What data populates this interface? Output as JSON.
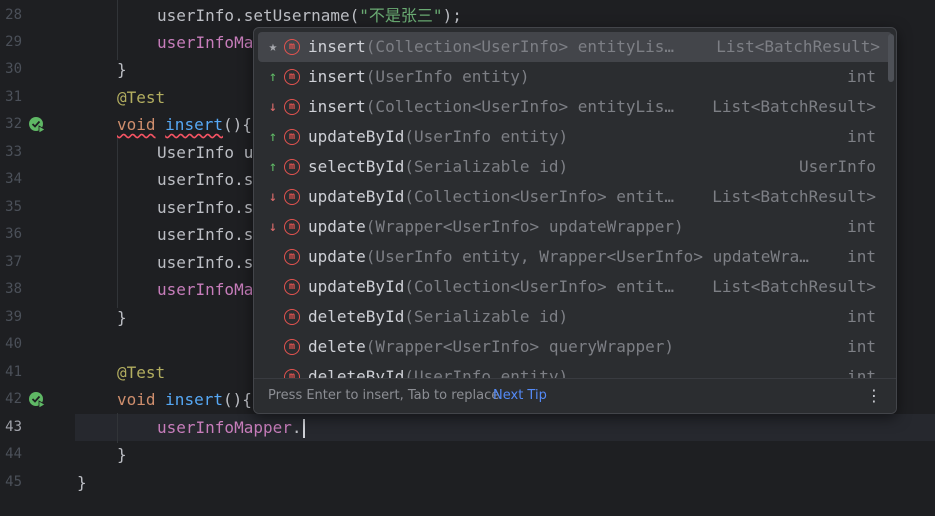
{
  "gutter": {
    "line_numbers": [
      "28",
      "29",
      "30",
      "31",
      "32",
      "33",
      "34",
      "35",
      "36",
      "37",
      "38",
      "39",
      "40",
      "41",
      "42",
      "43",
      "44",
      "45"
    ],
    "current_line": "43"
  },
  "code": {
    "l28": {
      "a": "userInfo.setUsername(",
      "b": "\"不是张三\"",
      "c": ");"
    },
    "l29": {
      "a": "userInfoMa"
    },
    "l30": {
      "a": "}"
    },
    "l31": {
      "a": "@Test"
    },
    "l32": {
      "kw": "void",
      "fn": "insert",
      "rest": "(){"
    },
    "l33": {
      "a": "UserInfo u"
    },
    "l34": {
      "a": "userInfo.s"
    },
    "l35": {
      "a": "userInfo.s"
    },
    "l36": {
      "a": "userInfo.s"
    },
    "l37": {
      "a": "userInfo.s"
    },
    "l38": {
      "a": "userInfoMa"
    },
    "l39": {
      "a": "}"
    },
    "l41": {
      "a": "@Test"
    },
    "l42": {
      "kw": "void",
      "fn": "insert",
      "rest": "(){"
    },
    "l43": {
      "a": "userInfoMapper",
      "b": "."
    },
    "l44": {
      "a": "}"
    },
    "l45": {
      "a": "}"
    }
  },
  "completion": {
    "items": [
      {
        "mark": "★",
        "name": "insert",
        "params": "(Collection<UserInfo> entityLis…",
        "rtype": "List<BatchResult>"
      },
      {
        "mark": "↑",
        "name": "insert",
        "params": "(UserInfo entity)",
        "rtype": "int"
      },
      {
        "mark": "↓",
        "name": "insert",
        "params": "(Collection<UserInfo> entityLis…",
        "rtype": "List<BatchResult>"
      },
      {
        "mark": "↑",
        "name": "updateById",
        "params": "(UserInfo entity)",
        "rtype": "int"
      },
      {
        "mark": "↑",
        "name": "selectById",
        "params": "(Serializable id)",
        "rtype": "UserInfo"
      },
      {
        "mark": "↓",
        "name": "updateById",
        "params": "(Collection<UserInfo> entit…",
        "rtype": "List<BatchResult>"
      },
      {
        "mark": "↓",
        "name": "update",
        "params": "(Wrapper<UserInfo> updateWrapper)",
        "rtype": "int"
      },
      {
        "mark": "",
        "name": "update",
        "params": "(UserInfo entity, Wrapper<UserInfo> updateWra…",
        "rtype": "int"
      },
      {
        "mark": "",
        "name": "updateById",
        "params": "(Collection<UserInfo> entit…",
        "rtype": "List<BatchResult>"
      },
      {
        "mark": "",
        "name": "deleteById",
        "params": "(Serializable id)",
        "rtype": "int"
      },
      {
        "mark": "",
        "name": "delete",
        "params": "(Wrapper<UserInfo> queryWrapper)",
        "rtype": "int"
      },
      {
        "mark": "",
        "name": "deleteById",
        "params": "(UserInfo entity)",
        "rtype": "int"
      }
    ],
    "method_icon_letter": "m",
    "footer_hint": "Press Enter to insert, Tab to replace",
    "footer_tip_link": "Next Tip",
    "footer_menu": "⋮"
  }
}
